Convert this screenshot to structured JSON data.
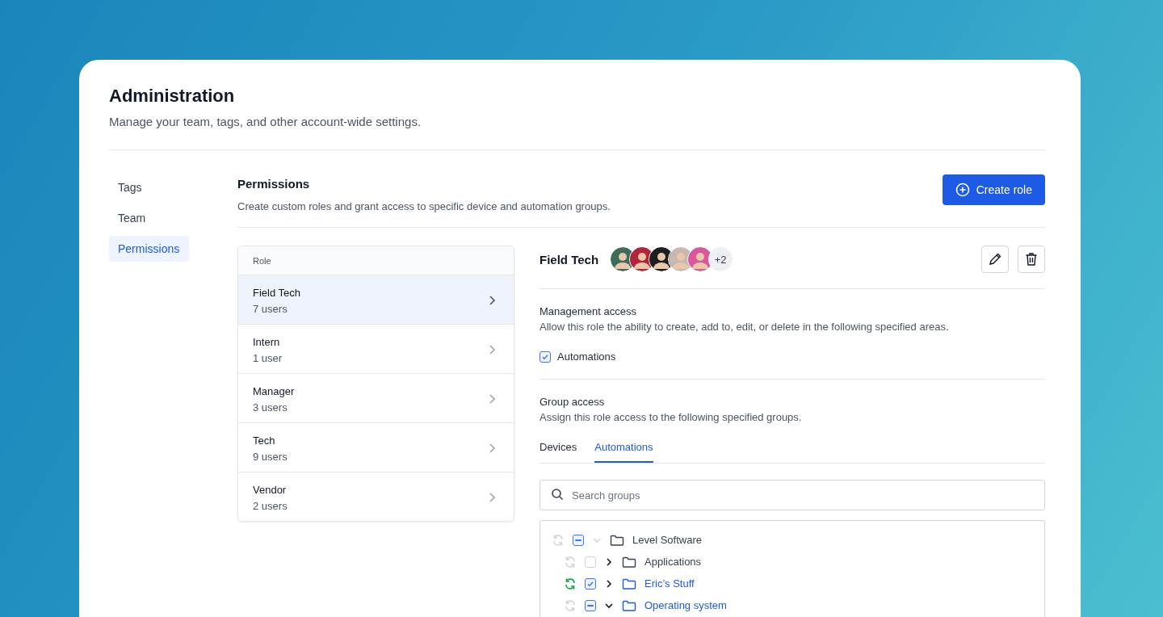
{
  "header": {
    "title": "Administration",
    "subtitle": "Manage your team, tags, and other account-wide settings."
  },
  "sidebar": {
    "items": [
      {
        "label": "Tags",
        "selected": false
      },
      {
        "label": "Team",
        "selected": false
      },
      {
        "label": "Permissions",
        "selected": true
      }
    ]
  },
  "section": {
    "title": "Permissions",
    "description": "Create custom roles and grant access to specific device and automation groups.",
    "create_button": "Create role"
  },
  "roles": {
    "column": "Role",
    "rows": [
      {
        "name": "Field Tech",
        "users": "7 users",
        "selected": true
      },
      {
        "name": "Intern",
        "users": "1 user",
        "selected": false
      },
      {
        "name": "Manager",
        "users": "3 users",
        "selected": false
      },
      {
        "name": "Tech",
        "users": "9 users",
        "selected": false
      },
      {
        "name": "Vendor",
        "users": "2 users",
        "selected": false
      }
    ]
  },
  "detail": {
    "title": "Field Tech",
    "avatars": [
      {
        "color": "#3f6b5a"
      },
      {
        "color": "#b3243a"
      },
      {
        "color": "#1e1e1e"
      },
      {
        "color": "#c9b8b0"
      },
      {
        "color": "#d9579a"
      }
    ],
    "more_count": "+2",
    "management": {
      "title": "Management access",
      "description": "Allow this role the ability to create, add to, edit, or delete in the following specified areas.",
      "options": [
        {
          "label": "Automations",
          "checked": true
        }
      ]
    },
    "group_access": {
      "title": "Group access",
      "description": "Assign this role access to the following specified groups.",
      "tabs": [
        {
          "label": "Devices",
          "selected": false
        },
        {
          "label": "Automations",
          "selected": true
        }
      ],
      "search": {
        "placeholder": "Search groups"
      },
      "tree": [
        {
          "label": "Level Software",
          "synced": false,
          "checked": false,
          "indeterminate": true,
          "expanded": true,
          "active": false,
          "children": [
            {
              "label": "Applications",
              "synced": false,
              "checked": false,
              "indeterminate": false,
              "expanded": false,
              "active": false
            },
            {
              "label": "Eric’s Stuff",
              "synced": true,
              "checked": true,
              "indeterminate": false,
              "expanded": false,
              "active": true
            },
            {
              "label": "Operating system",
              "synced": false,
              "checked": false,
              "indeterminate": true,
              "expanded": true,
              "active": true
            }
          ]
        }
      ]
    }
  }
}
